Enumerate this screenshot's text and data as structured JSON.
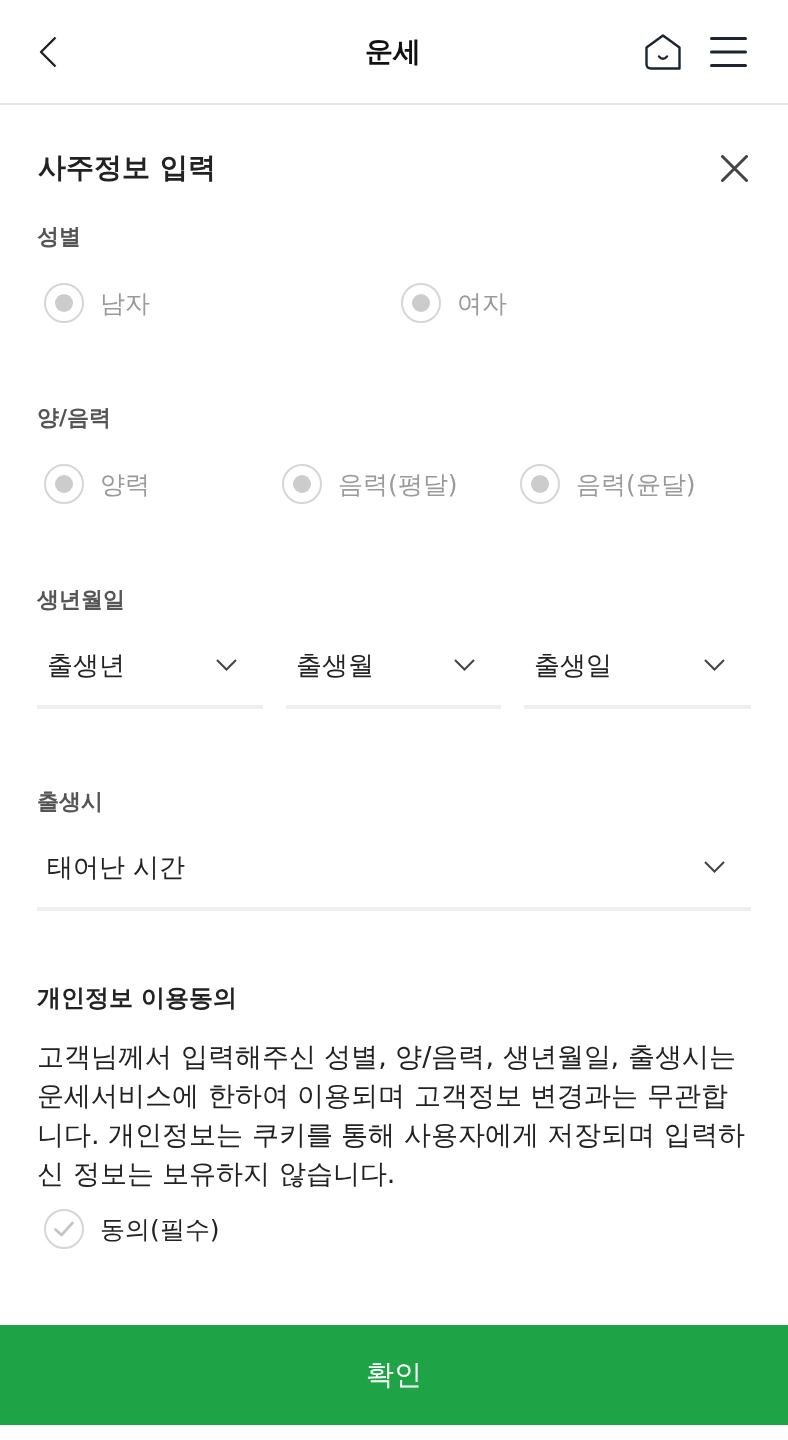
{
  "header": {
    "title": "운세"
  },
  "form": {
    "title": "사주정보 입력"
  },
  "gender": {
    "label": "성별",
    "options": [
      {
        "label": "남자",
        "selected": false
      },
      {
        "label": "여자",
        "selected": false
      }
    ]
  },
  "calendar_type": {
    "label": "양/음력",
    "options": [
      {
        "label": "양력",
        "selected": false
      },
      {
        "label": "음력(평달)",
        "selected": false
      },
      {
        "label": "음력(윤달)",
        "selected": false
      }
    ]
  },
  "birth_date": {
    "label": "생년월일",
    "selects": [
      {
        "placeholder": "출생년"
      },
      {
        "placeholder": "출생월"
      },
      {
        "placeholder": "출생일"
      }
    ]
  },
  "birth_time": {
    "label": "출생시",
    "select": {
      "placeholder": "태어난 시간"
    }
  },
  "consent": {
    "title": "개인정보 이용동의",
    "text": "고객님께서 입력해주신 성별, 양/음력, 생년월일, 출생시는 운세서비스에 한하여 이용되며 고객정보 변경과는 무관합니다. 개인정보는 쿠키를 통해 사용자에게 저장되며 입력하신 정보는 보유하지 않습니다.",
    "checkbox": {
      "label": "동의(필수)",
      "checked": false
    }
  },
  "confirm_button": {
    "label": "확인"
  }
}
